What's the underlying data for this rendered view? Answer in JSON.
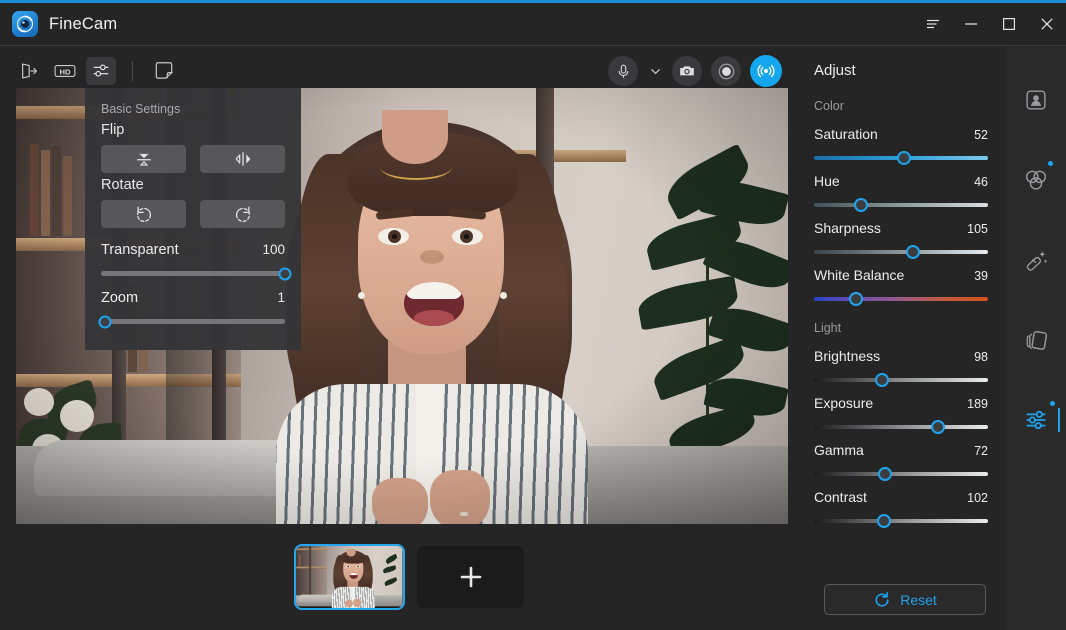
{
  "app": {
    "title": "FineCam",
    "logo_icon": "finecam-aperture-logo",
    "accent_color": "#1e8fd5"
  },
  "window_controls": [
    {
      "name": "menu-button",
      "icon": "hamburger-menu-icon"
    },
    {
      "name": "minimize-button",
      "icon": "minimize-icon"
    },
    {
      "name": "maximize-button",
      "icon": "maximize-icon"
    },
    {
      "name": "close-button",
      "icon": "close-icon"
    }
  ],
  "toolbar": {
    "left": [
      {
        "name": "exit-button",
        "icon": "exit-door-icon"
      },
      {
        "name": "hd-button",
        "icon": "hd-icon",
        "label": "HD"
      },
      {
        "name": "basic-settings-button",
        "icon": "sliders-icon",
        "active": true
      },
      {
        "name": "annotate-button",
        "icon": "sticker-eraser-icon"
      }
    ],
    "center": [
      {
        "name": "microphone-button",
        "icon": "microphone-icon"
      },
      {
        "name": "microphone-dropdown",
        "icon": "chevron-down-icon"
      },
      {
        "name": "snapshot-button",
        "icon": "camera-icon"
      },
      {
        "name": "record-button",
        "icon": "record-circle-icon"
      },
      {
        "name": "broadcast-button",
        "icon": "broadcast-signal-icon",
        "active": true
      }
    ]
  },
  "basic_settings": {
    "title": "Basic Settings",
    "flip_label": "Flip",
    "flip_buttons": [
      {
        "name": "flip-vertical-button",
        "icon": "flip-vertical-icon"
      },
      {
        "name": "flip-horizontal-button",
        "icon": "flip-horizontal-icon"
      }
    ],
    "rotate_label": "Rotate",
    "rotate_buttons": [
      {
        "name": "rotate-left-button",
        "icon": "rotate-counterclockwise-icon"
      },
      {
        "name": "rotate-right-button",
        "icon": "rotate-clockwise-icon"
      }
    ],
    "sliders": [
      {
        "label": "Transparent",
        "value": "100",
        "percent": 100
      },
      {
        "label": "Zoom",
        "value": "1",
        "percent": 2
      }
    ]
  },
  "thumbnails": {
    "selected_index": 0,
    "items": [
      {
        "name": "source-thumbnail-1"
      }
    ],
    "add_label": "+"
  },
  "adjust_panel": {
    "title": "Adjust",
    "groups": [
      {
        "title": "Color",
        "sliders": [
          {
            "label": "Saturation",
            "value": "52",
            "percent": 52
          },
          {
            "label": "Hue",
            "value": "46",
            "percent": 27
          },
          {
            "label": "Sharpness",
            "value": "105",
            "percent": 57
          },
          {
            "label": "White Balance",
            "value": "39",
            "percent": 24
          }
        ]
      },
      {
        "title": "Light",
        "sliders": [
          {
            "label": "Brightness",
            "value": "98",
            "percent": 39
          },
          {
            "label": "Exposure",
            "value": "189",
            "percent": 71
          },
          {
            "label": "Gamma",
            "value": "72",
            "percent": 41
          },
          {
            "label": "Contrast",
            "value": "102",
            "percent": 40
          }
        ]
      }
    ],
    "reset": {
      "label": "Reset",
      "icon": "refresh-circle-icon",
      "color": "#1ea4ef"
    }
  },
  "right_rail": [
    {
      "name": "rail-item-portrait",
      "icon": "portrait-frame-icon",
      "badge": false,
      "active": false
    },
    {
      "name": "rail-item-filters",
      "icon": "color-circles-icon",
      "badge": true,
      "active": false
    },
    {
      "name": "rail-item-beautify",
      "icon": "magic-wand-icon",
      "badge": false,
      "active": false
    },
    {
      "name": "rail-item-layers",
      "icon": "layers-cards-icon",
      "badge": false,
      "active": false
    },
    {
      "name": "rail-item-adjust",
      "icon": "sliders-icon",
      "badge": true,
      "active": true
    }
  ]
}
